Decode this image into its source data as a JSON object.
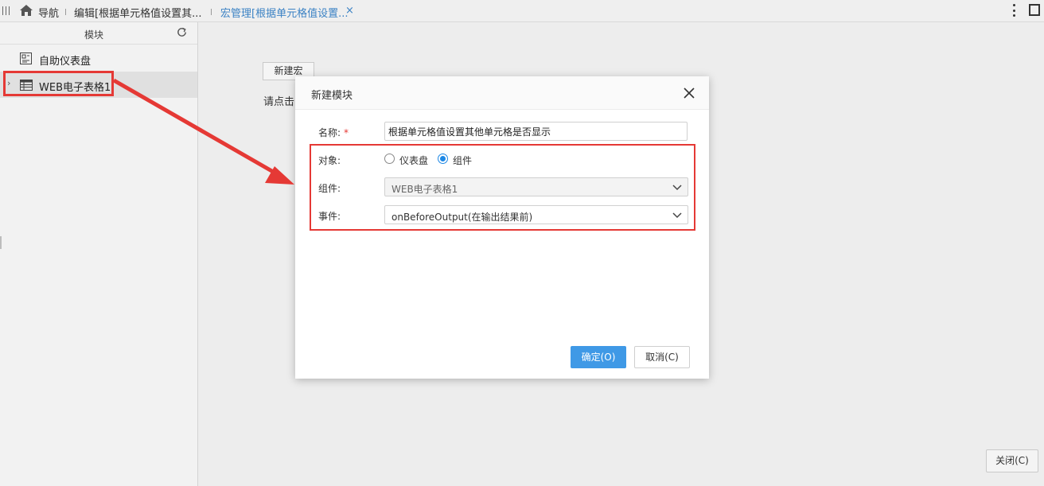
{
  "topbar": {
    "nav_label": "导航",
    "tab_edit_label": "编辑[根据单元格值设置其...",
    "tab_macro_label": "宏管理[根据单元格值设置...",
    "tab_close_glyph": "×"
  },
  "sidebar": {
    "title": "模块",
    "items": [
      {
        "label": "自助仪表盘",
        "icon": "dashboard-icon"
      },
      {
        "label": "WEB电子表格1",
        "icon": "table-icon",
        "expand_glyph": "›"
      }
    ]
  },
  "main": {
    "new_macro_label": "新建宏",
    "hint_text": "请点击",
    "close_label": "关闭(C)"
  },
  "dialog": {
    "title": "新建模块",
    "name_label": "名称:",
    "required_mark": "*",
    "name_value": "根据单元格值设置其他单元格是否显示",
    "object_label": "对象:",
    "object_options": [
      "仪表盘",
      "组件"
    ],
    "object_selected": "组件",
    "component_label": "组件:",
    "component_value": "WEB电子表格1",
    "event_label": "事件:",
    "event_value": "onBeforeOutput(在输出结果前)",
    "ok_label": "确定(O)",
    "cancel_label": "取消(C)"
  },
  "colors": {
    "accent": "#3f99e6",
    "annotation_red": "#e53935",
    "active_tab": "#3b82c4"
  }
}
